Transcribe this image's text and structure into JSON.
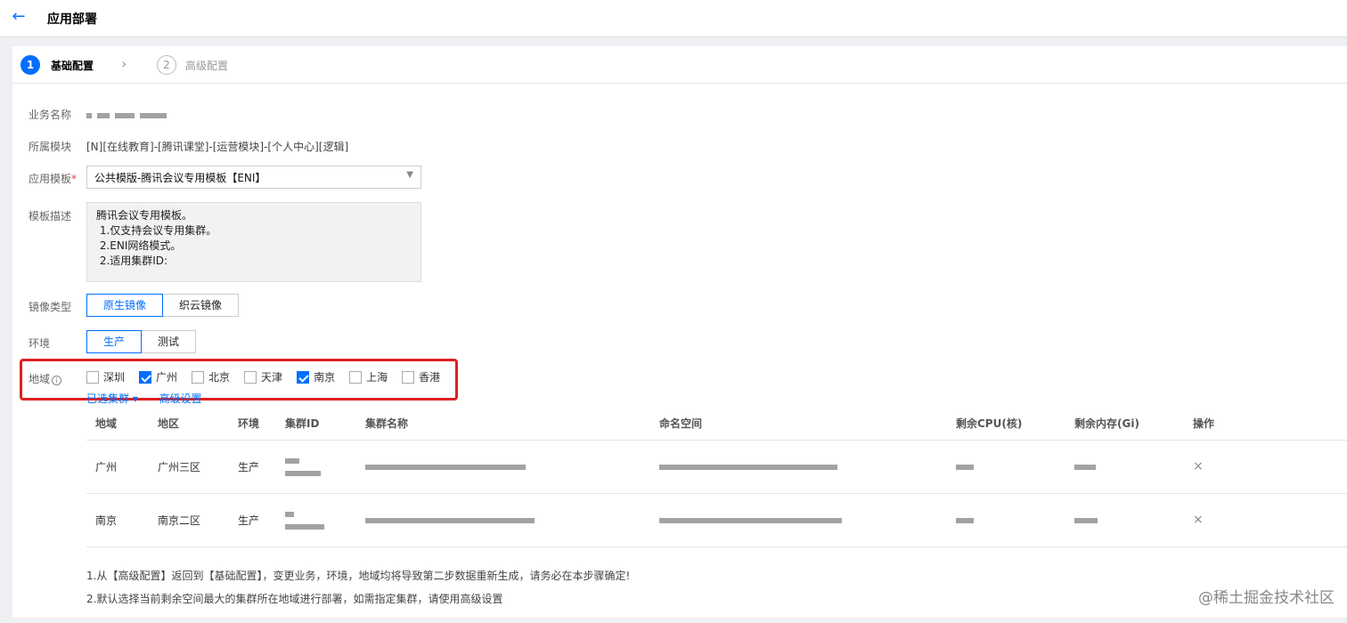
{
  "header": {
    "back_icon": "arrow-left-icon",
    "title": "应用部署"
  },
  "steps": [
    {
      "num": "1",
      "label": "基础配置",
      "active": true
    },
    {
      "num": "2",
      "label": "高级配置",
      "active": false
    }
  ],
  "form": {
    "business_name_label": "业务名称",
    "module_label": "所属模块",
    "module_value": "[N][在线教育]-[腾讯课堂]-[运营模块]-[个人中心][逻辑]",
    "template_label": "应用模板",
    "template_required": "*",
    "template_value": "公共模版-腾讯会议专用模板【ENI】",
    "template_desc_label": "模板描述",
    "template_desc": "腾讯会议专用模板。\n 1.仅支持会议专用集群。\n 2.ENI网络模式。\n 2.适用集群ID:",
    "image_type_label": "镜像类型",
    "image_type_options": [
      "原生镜像",
      "织云镜像"
    ],
    "env_label": "环境",
    "env_options": [
      "生产",
      "测试"
    ],
    "region_label": "地域",
    "regions": [
      {
        "name": "深圳",
        "checked": false
      },
      {
        "name": "广州",
        "checked": true
      },
      {
        "name": "北京",
        "checked": false
      },
      {
        "name": "天津",
        "checked": false
      },
      {
        "name": "南京",
        "checked": true
      },
      {
        "name": "上海",
        "checked": false
      },
      {
        "name": "香港",
        "checked": false
      }
    ],
    "selected_clusters_link": "已选集群 ▾",
    "advanced_link": "高级设置"
  },
  "table": {
    "headers": [
      "地域",
      "地区",
      "环境",
      "集群ID",
      "集群名称",
      "命名空间",
      "剩余CPU(核)",
      "剩余内存(Gi)",
      "操作"
    ],
    "rows": [
      {
        "region": "广州",
        "area": "广州三区",
        "env": "生产",
        "action": "×"
      },
      {
        "region": "南京",
        "area": "南京二区",
        "env": "生产",
        "action": "×"
      }
    ]
  },
  "notes": [
    "1.从【高级配置】返回到【基础配置】，变更业务，环境，地域均将导致第二步数据重新生成，请务必在本步骤确定!",
    "2.默认选择当前剩余空间最大的集群所在地域进行部署，如需指定集群，请使用高级设置"
  ],
  "watermark": "@稀土掘金技术社区"
}
